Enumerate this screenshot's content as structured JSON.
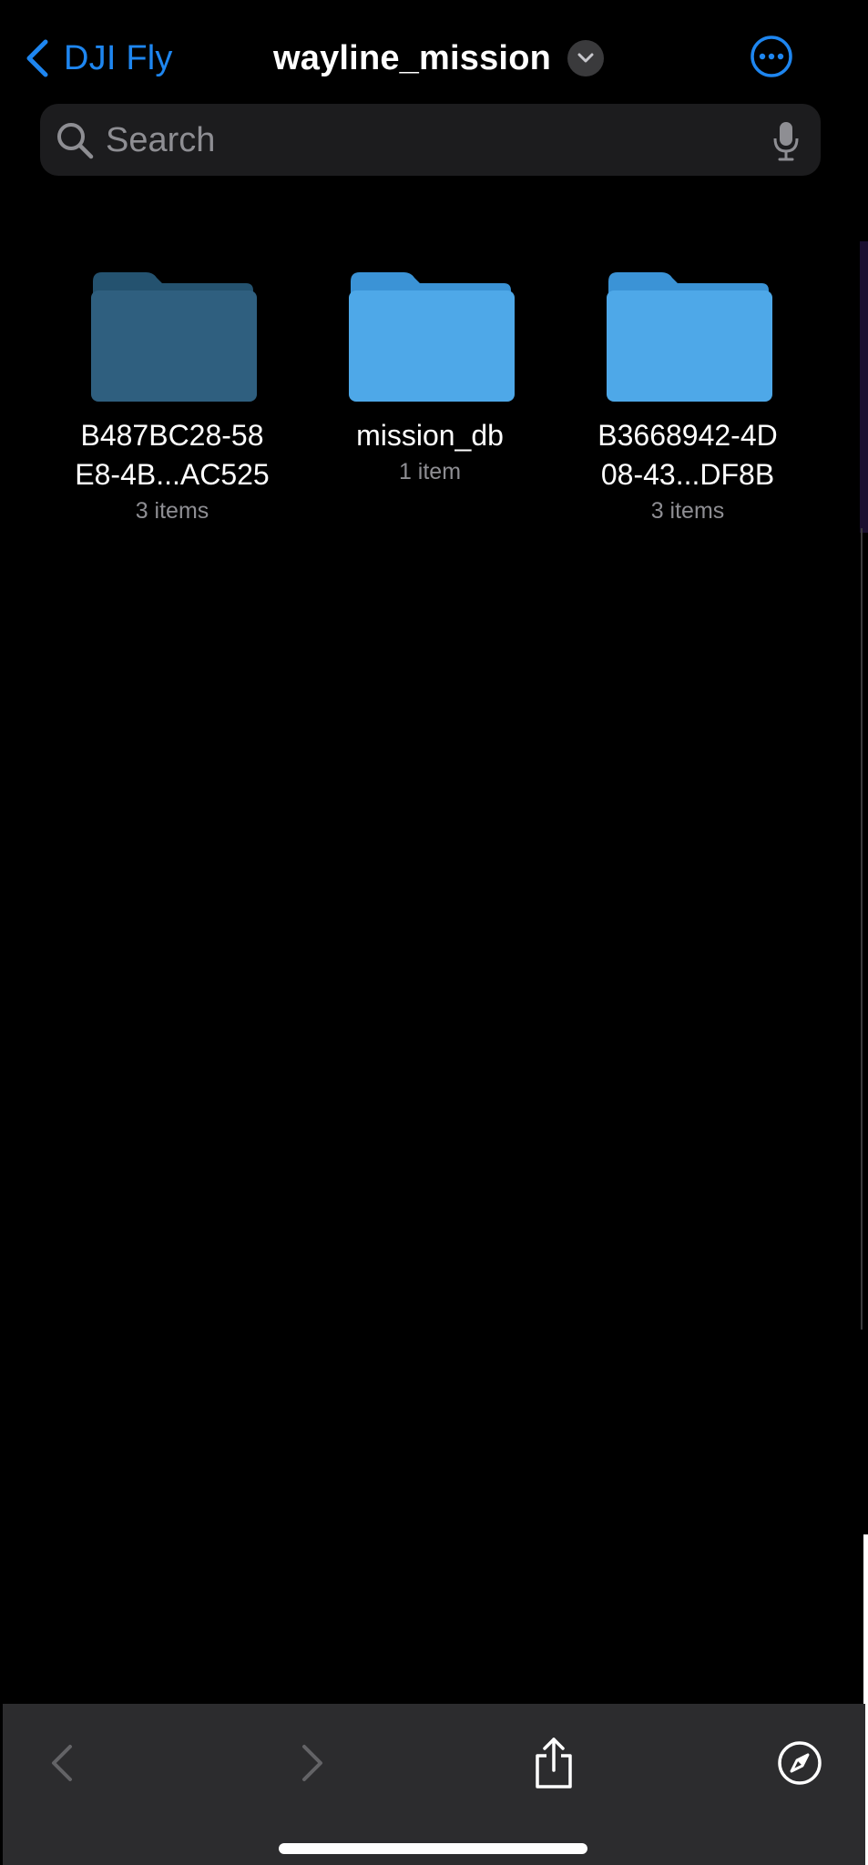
{
  "nav": {
    "back_label": "DJI Fly",
    "title": "wayline_mission"
  },
  "search": {
    "placeholder": "Search"
  },
  "folders": [
    {
      "name": "B487BC28-58\nE8-4B...AC525",
      "meta": "3 items",
      "color": "#2f5f7f",
      "tab_color": "#24526f"
    },
    {
      "name": "mission_db",
      "meta": "1 item",
      "color": "#4ea8e8",
      "tab_color": "#3b93d6"
    },
    {
      "name": "B3668942-4D\n08-43...DF8B",
      "meta": "3 items",
      "color": "#4ea8e8",
      "tab_color": "#3b93d6"
    }
  ],
  "toolbar": {
    "icons": [
      "back-arrow-icon",
      "forward-arrow-icon",
      "share-icon",
      "compass-icon"
    ]
  },
  "colors": {
    "accent": "#1e86f0",
    "background": "#000000",
    "toolbar": "#2c2c2e"
  }
}
